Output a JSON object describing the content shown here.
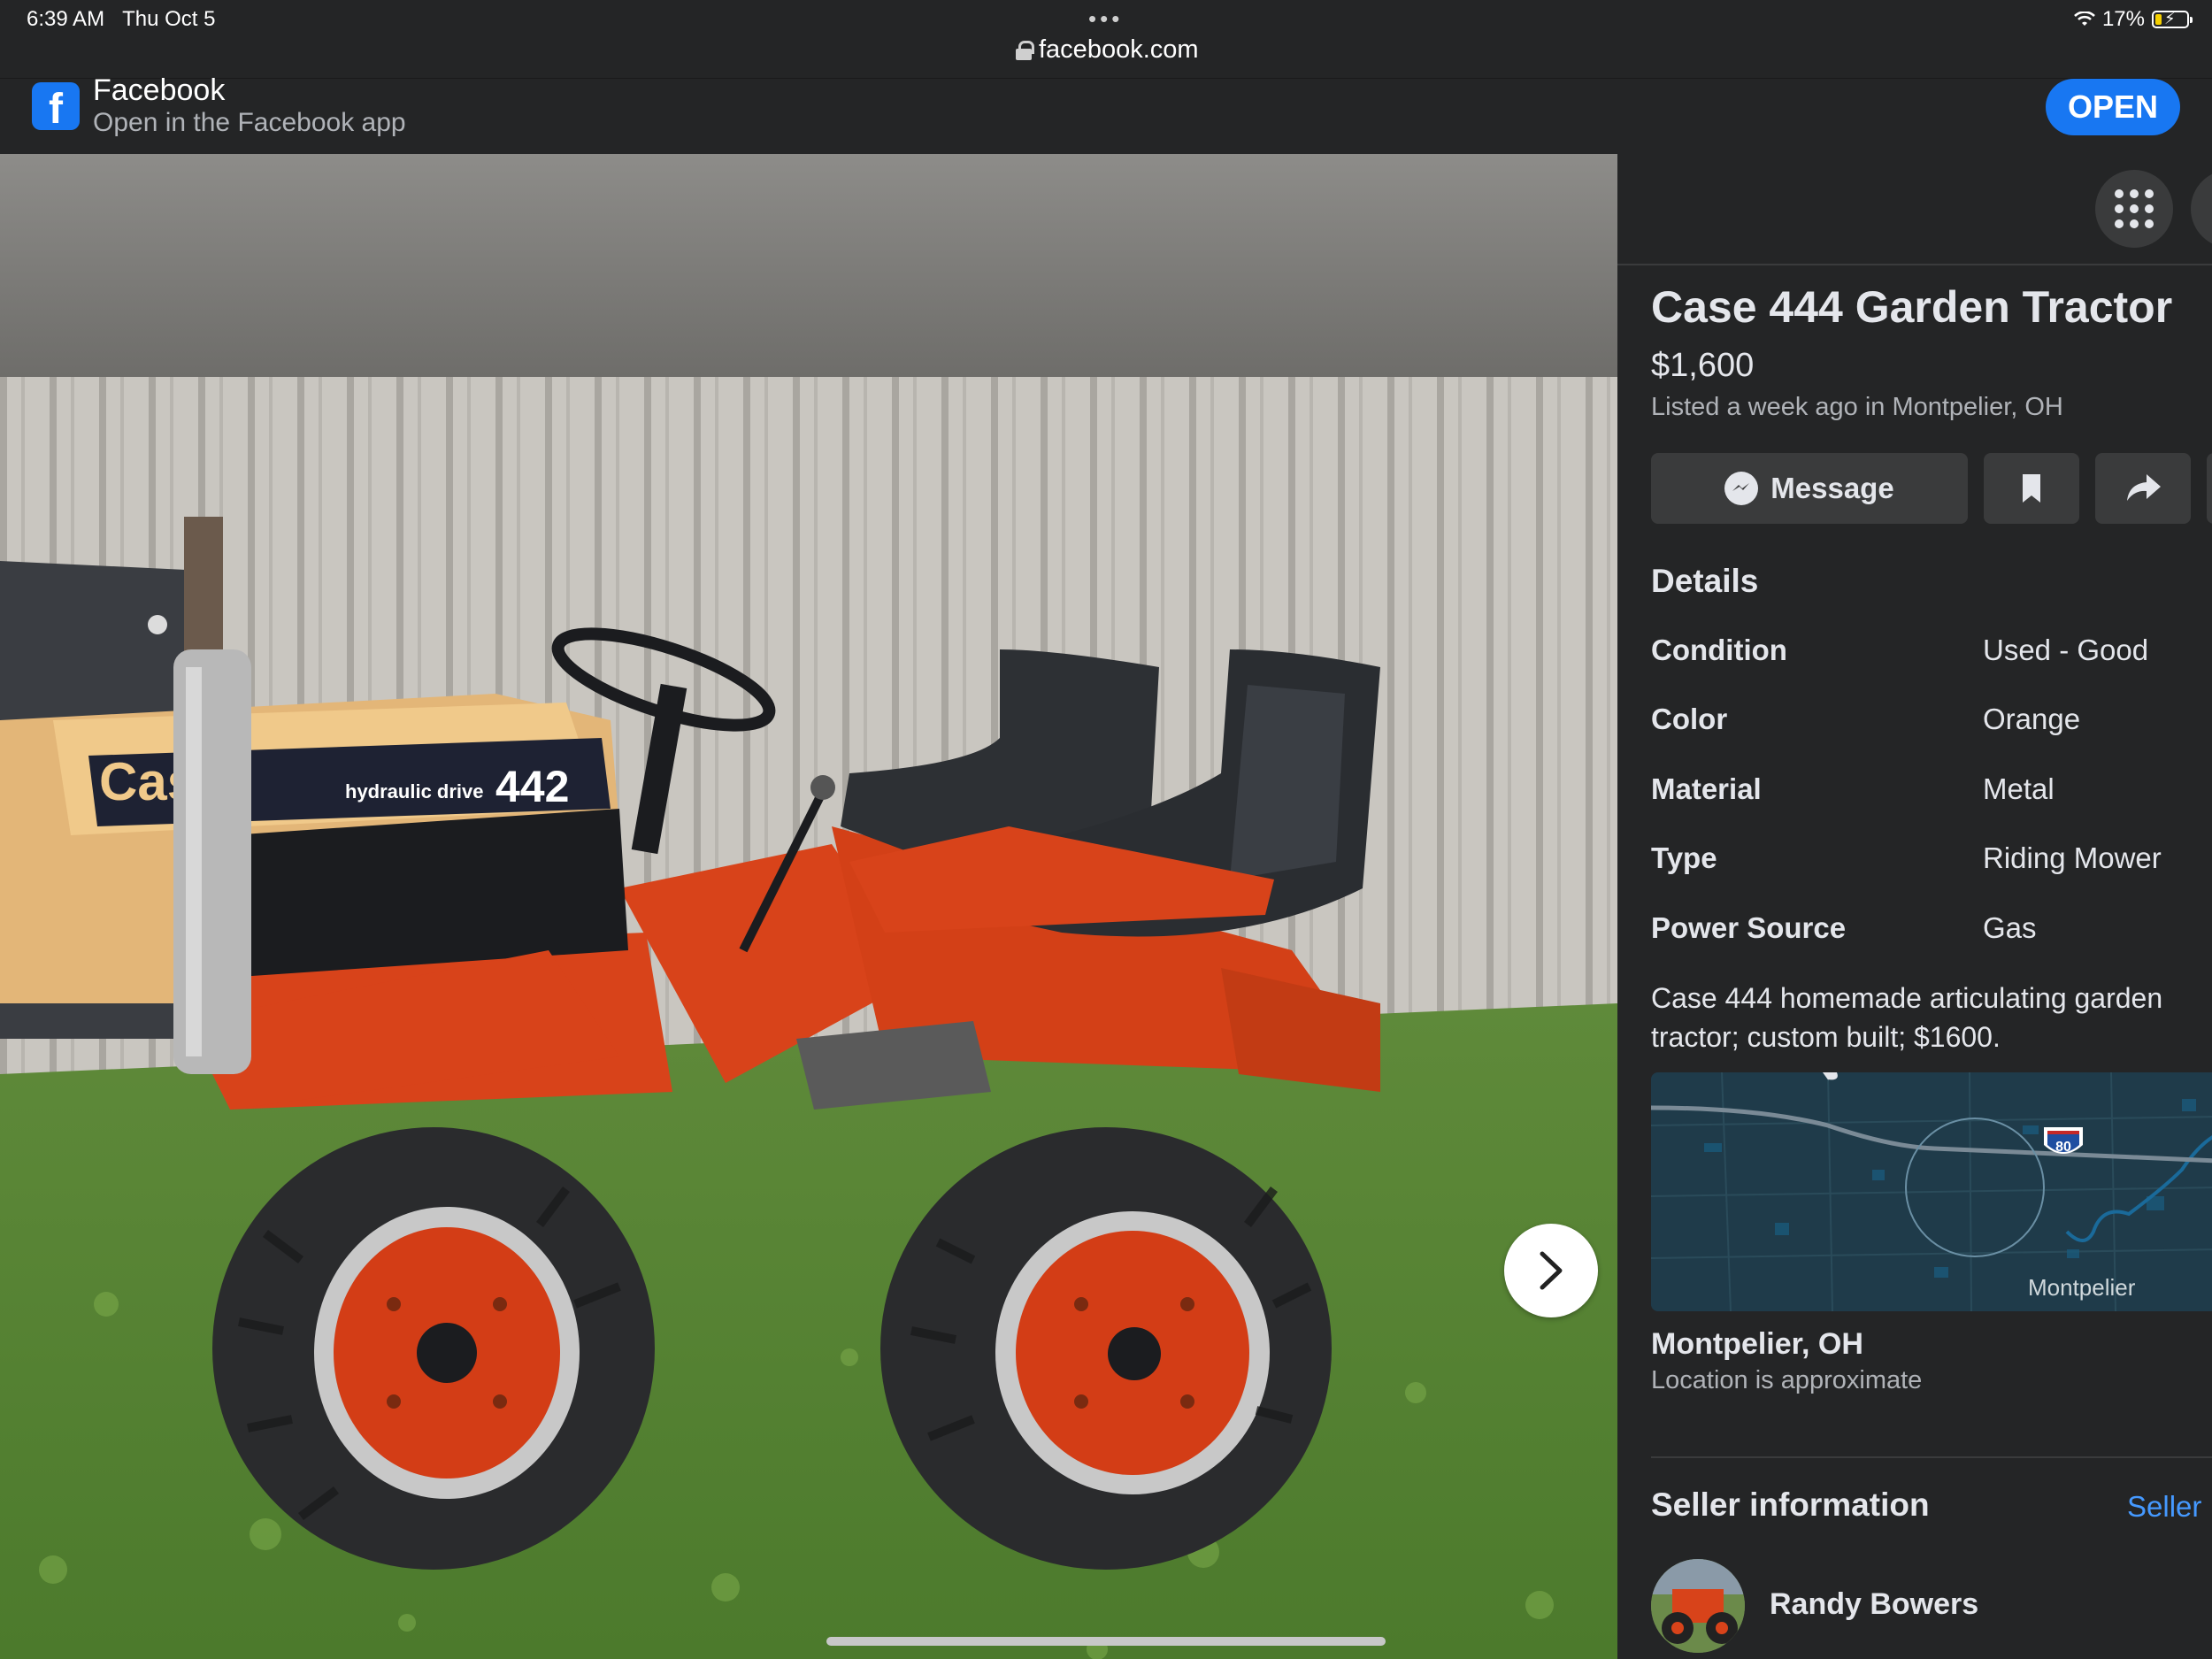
{
  "status_bar": {
    "time": "6:39 AM",
    "date": "Thu Oct 5",
    "url": "facebook.com",
    "battery": "17%",
    "dots": "•••"
  },
  "app_banner": {
    "title": "Facebook",
    "subtitle": "Open in the Facebook app",
    "open_label": "OPEN"
  },
  "photo": {
    "badge_text": "Case",
    "hood_text": "hydraulic drive",
    "model_number": "442",
    "next_icon": "chevron-right-icon"
  },
  "listing": {
    "title": "Case 444 Garden Tractor",
    "price": "$1,600",
    "listed": "Listed a week ago in Montpelier, OH",
    "message_label": "Message",
    "details_heading": "Details",
    "details": [
      {
        "key": "Condition",
        "value": "Used - Good"
      },
      {
        "key": "Color",
        "value": "Orange"
      },
      {
        "key": "Material",
        "value": "Metal"
      },
      {
        "key": "Type",
        "value": "Riding Mower"
      },
      {
        "key": "Power Source",
        "value": "Gas"
      }
    ],
    "description": "Case 444 homemade articulating garden tractor; custom built; $1600.",
    "map": {
      "highway": "80",
      "label": "Montpelier"
    },
    "location_title": "Montpelier, OH",
    "location_sub": "Location is approximate",
    "seller_heading": "Seller information",
    "seller_link": "Seller",
    "seller_name": "Randy Bowers"
  },
  "colors": {
    "accent": "#1877f2",
    "panel_bg": "#242526",
    "button_bg": "#3a3b3c",
    "link": "#4599ff"
  }
}
